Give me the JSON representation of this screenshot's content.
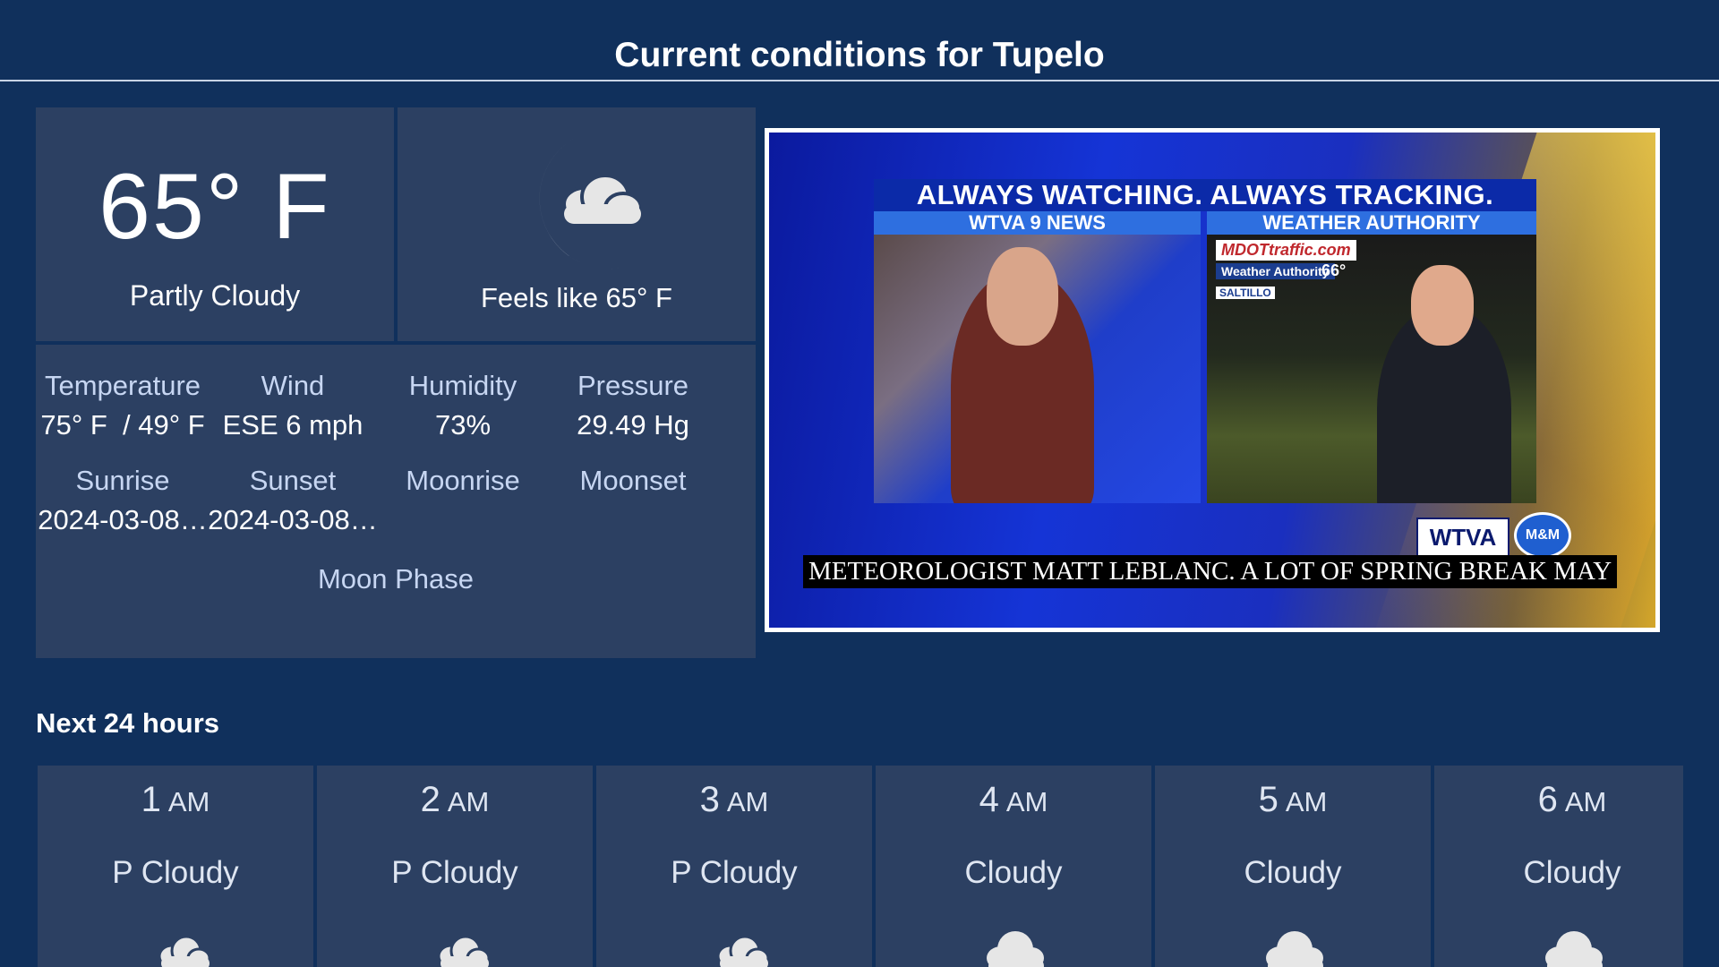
{
  "header": {
    "title": "Current conditions for Tupelo"
  },
  "current": {
    "temperature": "65° F",
    "condition": "Partly Cloudy",
    "feels_like": "Feels like 65° F",
    "icon": "moon-cloud-icon"
  },
  "details": {
    "temperature_label": "Temperature",
    "temperature_value": "75° F  / 49° F",
    "wind_label": "Wind",
    "wind_value": "ESE 6 mph",
    "humidity_label": "Humidity",
    "humidity_value": "73%",
    "pressure_label": "Pressure",
    "pressure_value": "29.49 Hg",
    "sunrise_label": "Sunrise",
    "sunrise_value": "2024-03-08…",
    "sunset_label": "Sunset",
    "sunset_value": "2024-03-08…",
    "moonrise_label": "Moonrise",
    "moonset_label": "Moonset",
    "moon_phase_label": "Moon Phase"
  },
  "video": {
    "banner": "ALWAYS WATCHING. ALWAYS TRACKING.",
    "left_sub": "WTVA 9 NEWS",
    "right_sub": "WEATHER AUTHORITY",
    "mdot": "MDOTtraffic.com",
    "weather_authority": "Weather Authority",
    "temp_badge": "66°",
    "location_badge": "SALTILLO",
    "logo": "WTVA",
    "mm_logo": "M&M",
    "caption": "METEOROLOGIST MATT LEBLANC. A LOT OF SPRING BREAK MAY"
  },
  "forecast": {
    "title": "Next 24 hours",
    "hours": [
      {
        "hour": "1",
        "ampm": "AM",
        "condition": "P Cloudy",
        "icon": "moon-cloud-icon"
      },
      {
        "hour": "2",
        "ampm": "AM",
        "condition": "P Cloudy",
        "icon": "moon-cloud-icon"
      },
      {
        "hour": "3",
        "ampm": "AM",
        "condition": "P Cloudy",
        "icon": "moon-cloud-icon"
      },
      {
        "hour": "4",
        "ampm": "AM",
        "condition": "Cloudy",
        "icon": "cloud-icon"
      },
      {
        "hour": "5",
        "ampm": "AM",
        "condition": "Cloudy",
        "icon": "cloud-icon"
      },
      {
        "hour": "6",
        "ampm": "AM",
        "condition": "Cloudy",
        "icon": "cloud-icon"
      }
    ]
  },
  "colors": {
    "background": "#10305c",
    "panel": "#2c4062",
    "label": "#c7d6f2"
  }
}
